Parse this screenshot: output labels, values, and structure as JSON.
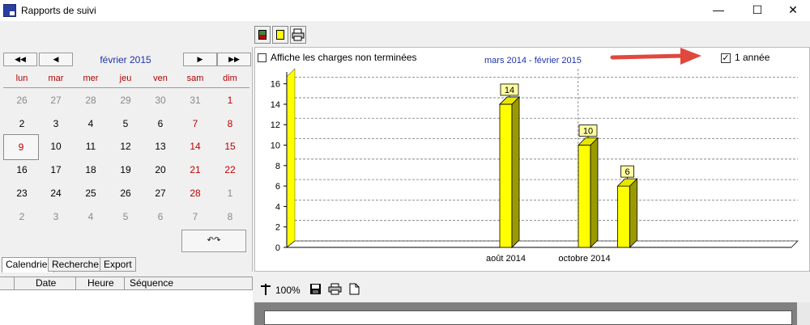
{
  "window": {
    "title": "Rapports de suivi",
    "controls": [
      "—",
      "☐",
      "✕"
    ]
  },
  "toolbar": {
    "buttons": [
      {
        "name": "color-red-green",
        "colors": [
          "#3a8a3a",
          "#c00000"
        ]
      },
      {
        "name": "color-yellow",
        "colors": [
          "#ffff00"
        ]
      },
      {
        "name": "print",
        "icon": "printer-icon"
      }
    ]
  },
  "calendar": {
    "month": "février 2015",
    "nav": {
      "prev_year": "◀◀",
      "prev_month": "◀",
      "next_month": "▶",
      "next_year": "▶▶"
    },
    "days": [
      "lun",
      "mar",
      "mer",
      "jeu",
      "ven",
      "sam",
      "dim"
    ],
    "weeks": [
      [
        "26",
        "27",
        "28",
        "29",
        "30",
        "31",
        "1"
      ],
      [
        "2",
        "3",
        "4",
        "5",
        "6",
        "7",
        "8"
      ],
      [
        "9",
        "10",
        "11",
        "12",
        "13",
        "14",
        "15"
      ],
      [
        "16",
        "17",
        "18",
        "19",
        "20",
        "21",
        "22"
      ],
      [
        "23",
        "24",
        "25",
        "26",
        "27",
        "28",
        "1"
      ],
      [
        "2",
        "3",
        "4",
        "5",
        "6",
        "7",
        "8"
      ]
    ],
    "today_label": "↶↷",
    "tabs": [
      "Calendrier",
      "Recherche",
      "Export"
    ]
  },
  "chart_panel": {
    "checkbox_label": "Affiche les charges non terminées",
    "annee_label": "1 année",
    "annee_mark": "✓"
  },
  "chart_data": {
    "type": "bar",
    "title": "mars 2014 - février 2015",
    "ylim": [
      0,
      17
    ],
    "yticks": [
      "0",
      "2",
      "4",
      "6",
      "8",
      "10",
      "12",
      "14",
      "16"
    ],
    "bars": [
      {
        "month_index": 5,
        "value": 14
      },
      {
        "month_index": 7,
        "value": 10
      },
      {
        "month_index": 8,
        "value": 6
      }
    ],
    "xlabels": [
      {
        "month_index": 5,
        "label": "août 2014"
      },
      {
        "month_index": 7,
        "label": "octobre 2014"
      }
    ],
    "bar_color": "#ffff00",
    "bar_side_color": "#9a9a00",
    "grid": true
  },
  "list": {
    "columns": [
      "Date",
      "Heure",
      "Séquence"
    ]
  },
  "report": {
    "zoom": "100%"
  }
}
